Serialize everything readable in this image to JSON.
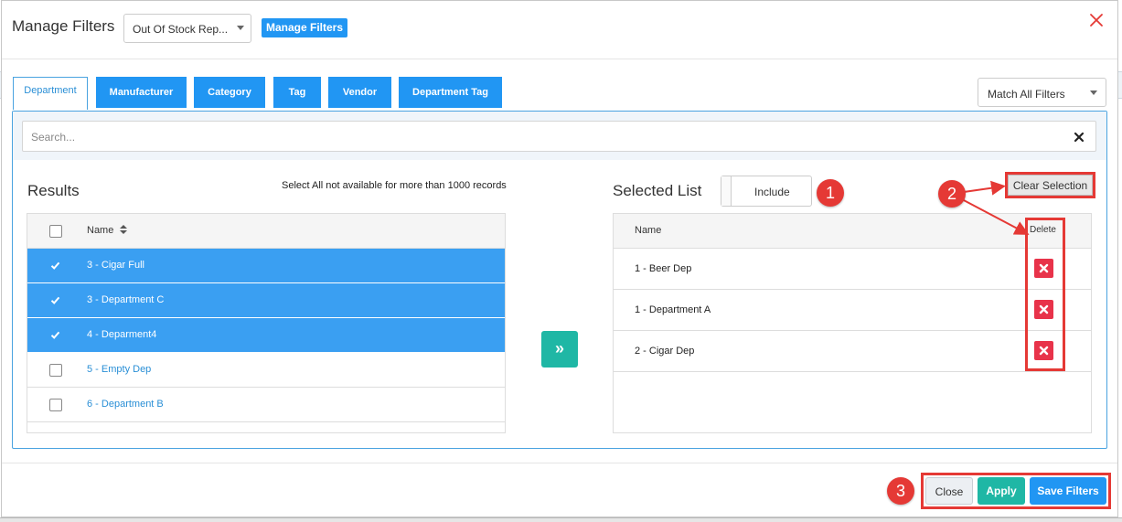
{
  "header": {
    "title": "Manage Filters",
    "filter_select_value": "Out Of Stock Rep...",
    "manage_button": "Manage Filters"
  },
  "tabs": [
    {
      "label": "Department",
      "active": true
    },
    {
      "label": "Manufacturer",
      "active": false
    },
    {
      "label": "Category",
      "active": false
    },
    {
      "label": "Tag",
      "active": false
    },
    {
      "label": "Vendor",
      "active": false
    },
    {
      "label": "Department Tag",
      "active": false
    }
  ],
  "match_select_value": "Match All Filters",
  "search": {
    "placeholder": "Search..."
  },
  "results": {
    "title": "Results",
    "note": "Select All not available for more than 1000 records",
    "column_name": "Name",
    "sort_icon": "sort-icon",
    "rows": [
      {
        "label": "3 - Cigar Full",
        "checked": true
      },
      {
        "label": "3 - Department C",
        "checked": true
      },
      {
        "label": "4 - Deparment4",
        "checked": true
      },
      {
        "label": "5 - Empty Dep",
        "checked": false
      },
      {
        "label": "6 - Department B",
        "checked": false
      }
    ]
  },
  "transfer_button": "»",
  "selected": {
    "title": "Selected List",
    "include_label": "Include",
    "clear_label": "Clear Selection",
    "column_name": "Name",
    "column_delete": "Delete",
    "rows": [
      "1 - Beer Dep",
      "1 - Department A",
      "2 - Cigar Dep"
    ]
  },
  "annotations": [
    "1",
    "2",
    "3"
  ],
  "footer": {
    "close": "Close",
    "apply": "Apply",
    "save": "Save Filters"
  },
  "colors": {
    "primary": "#2196f3",
    "teal": "#1fb7a5",
    "delete": "#e8334a",
    "annotation": "#e53935"
  }
}
